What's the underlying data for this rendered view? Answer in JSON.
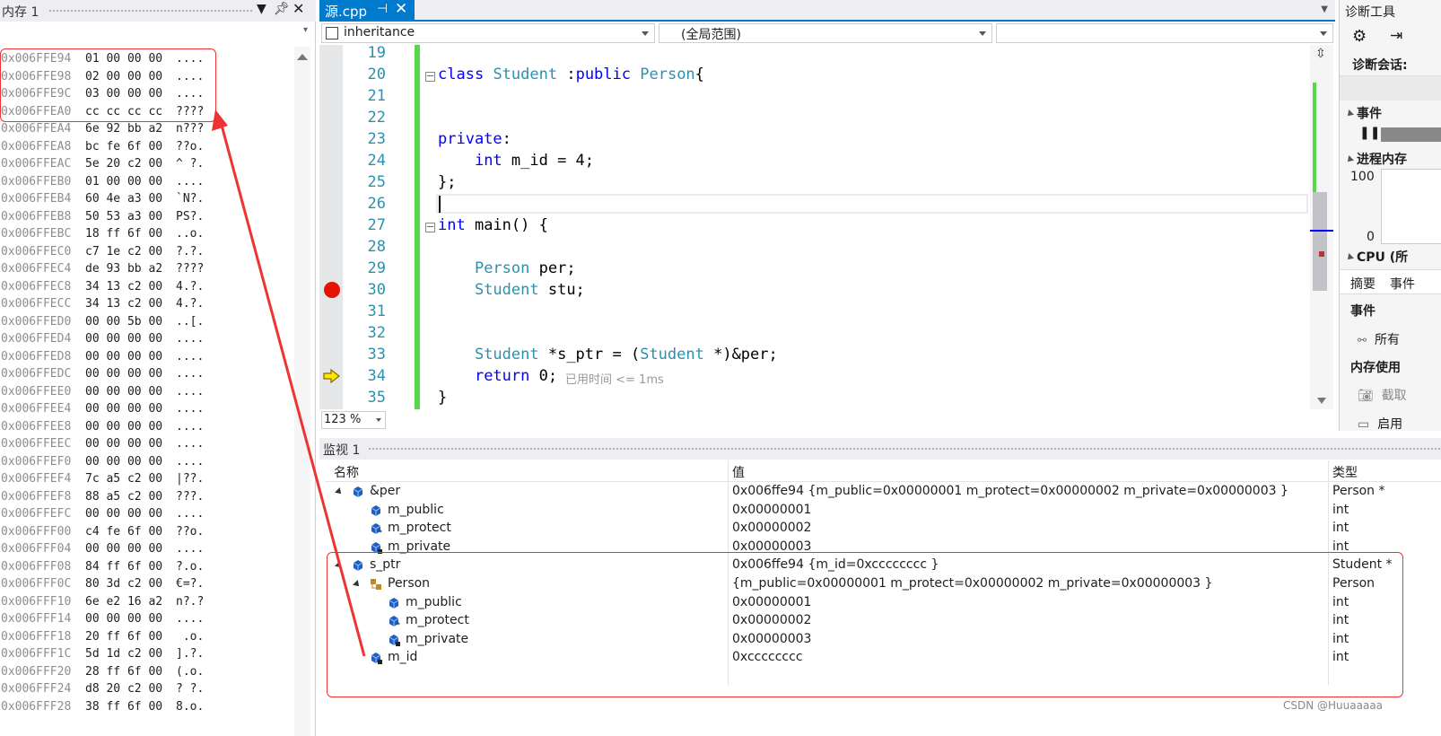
{
  "memory": {
    "title": "内存 1",
    "rows": [
      {
        "addr": "0x006FFE94",
        "hex": "01 00 00 00",
        "ascii": "...."
      },
      {
        "addr": "0x006FFE98",
        "hex": "02 00 00 00",
        "ascii": "...."
      },
      {
        "addr": "0x006FFE9C",
        "hex": "03 00 00 00",
        "ascii": "...."
      },
      {
        "addr": "0x006FFEA0",
        "hex": "cc cc cc cc",
        "ascii": "????"
      },
      {
        "addr": "0x006FFEA4",
        "hex": "6e 92 bb a2",
        "ascii": "n???"
      },
      {
        "addr": "0x006FFEA8",
        "hex": "bc fe 6f 00",
        "ascii": "??o."
      },
      {
        "addr": "0x006FFEAC",
        "hex": "5e 20 c2 00",
        "ascii": "^ ?."
      },
      {
        "addr": "0x006FFEB0",
        "hex": "01 00 00 00",
        "ascii": "...."
      },
      {
        "addr": "0x006FFEB4",
        "hex": "60 4e a3 00",
        "ascii": "`N?."
      },
      {
        "addr": "0x006FFEB8",
        "hex": "50 53 a3 00",
        "ascii": "PS?."
      },
      {
        "addr": "0x006FFEBC",
        "hex": "18 ff 6f 00",
        "ascii": "..o."
      },
      {
        "addr": "0x006FFEC0",
        "hex": "c7 1e c2 00",
        "ascii": "?.?."
      },
      {
        "addr": "0x006FFEC4",
        "hex": "de 93 bb a2",
        "ascii": "????"
      },
      {
        "addr": "0x006FFEC8",
        "hex": "34 13 c2 00",
        "ascii": "4.?."
      },
      {
        "addr": "0x006FFECC",
        "hex": "34 13 c2 00",
        "ascii": "4.?."
      },
      {
        "addr": "0x006FFED0",
        "hex": "00 00 5b 00",
        "ascii": "..[."
      },
      {
        "addr": "0x006FFED4",
        "hex": "00 00 00 00",
        "ascii": "...."
      },
      {
        "addr": "0x006FFED8",
        "hex": "00 00 00 00",
        "ascii": "...."
      },
      {
        "addr": "0x006FFEDC",
        "hex": "00 00 00 00",
        "ascii": "...."
      },
      {
        "addr": "0x006FFEE0",
        "hex": "00 00 00 00",
        "ascii": "...."
      },
      {
        "addr": "0x006FFEE4",
        "hex": "00 00 00 00",
        "ascii": "...."
      },
      {
        "addr": "0x006FFEE8",
        "hex": "00 00 00 00",
        "ascii": "...."
      },
      {
        "addr": "0x006FFEEC",
        "hex": "00 00 00 00",
        "ascii": "...."
      },
      {
        "addr": "0x006FFEF0",
        "hex": "00 00 00 00",
        "ascii": "...."
      },
      {
        "addr": "0x006FFEF4",
        "hex": "7c a5 c2 00",
        "ascii": "|??."
      },
      {
        "addr": "0x006FFEF8",
        "hex": "88 a5 c2 00",
        "ascii": "???."
      },
      {
        "addr": "0x006FFEFC",
        "hex": "00 00 00 00",
        "ascii": "...."
      },
      {
        "addr": "0x006FFF00",
        "hex": "c4 fe 6f 00",
        "ascii": "??o."
      },
      {
        "addr": "0x006FFF04",
        "hex": "00 00 00 00",
        "ascii": "...."
      },
      {
        "addr": "0x006FFF08",
        "hex": "84 ff 6f 00",
        "ascii": "?.o."
      },
      {
        "addr": "0x006FFF0C",
        "hex": "80 3d c2 00",
        "ascii": "€=?."
      },
      {
        "addr": "0x006FFF10",
        "hex": "6e e2 16 a2",
        "ascii": "n?.?"
      },
      {
        "addr": "0x006FFF14",
        "hex": "00 00 00 00",
        "ascii": "...."
      },
      {
        "addr": "0x006FFF18",
        "hex": "20 ff 6f 00",
        "ascii": " .o."
      },
      {
        "addr": "0x006FFF1C",
        "hex": "5d 1d c2 00",
        "ascii": "].?."
      },
      {
        "addr": "0x006FFF20",
        "hex": "28 ff 6f 00",
        "ascii": "(.o."
      },
      {
        "addr": "0x006FFF24",
        "hex": "d8 20 c2 00",
        "ascii": "? ?."
      },
      {
        "addr": "0x006FFF28",
        "hex": "38 ff 6f 00",
        "ascii": "8.o."
      }
    ]
  },
  "editor": {
    "tab": "源.cpp",
    "nav": {
      "project": "inheritance",
      "scope": "(全局范围)",
      "member": ""
    },
    "zoom": "123 %",
    "perf_tip": "已用时间 <= 1ms",
    "lines": [
      {
        "no": "19",
        "tokens": []
      },
      {
        "no": "20",
        "tokens": [
          {
            "t": "class",
            "c": "kw"
          },
          {
            "t": " Student :",
            "c": "ty-mix1"
          },
          {
            "t": "public",
            "c": "kw"
          },
          {
            "t": " Person{",
            "c": "ty-mix2"
          }
        ]
      },
      {
        "no": "21",
        "tokens": []
      },
      {
        "no": "22",
        "tokens": []
      },
      {
        "no": "23",
        "tokens": [
          {
            "t": "private",
            "c": "kw"
          },
          {
            "t": ":",
            "c": ""
          }
        ]
      },
      {
        "no": "24",
        "tokens": [
          {
            "t": "    ",
            "c": ""
          },
          {
            "t": "int",
            "c": "kw"
          },
          {
            "t": " m_id = 4;",
            "c": ""
          }
        ]
      },
      {
        "no": "25",
        "tokens": [
          {
            "t": "};",
            "c": ""
          }
        ]
      },
      {
        "no": "26",
        "tokens": []
      },
      {
        "no": "27",
        "tokens": [
          {
            "t": "int",
            "c": "kw"
          },
          {
            "t": " main() {",
            "c": ""
          }
        ]
      },
      {
        "no": "28",
        "tokens": []
      },
      {
        "no": "29",
        "tokens": [
          {
            "t": "    ",
            "c": ""
          },
          {
            "t": "Person",
            "c": "ty"
          },
          {
            "t": " per;",
            "c": ""
          }
        ]
      },
      {
        "no": "30",
        "tokens": [
          {
            "t": "    ",
            "c": ""
          },
          {
            "t": "Student",
            "c": "ty"
          },
          {
            "t": " stu;",
            "c": ""
          }
        ]
      },
      {
        "no": "31",
        "tokens": []
      },
      {
        "no": "32",
        "tokens": []
      },
      {
        "no": "33",
        "tokens": [
          {
            "t": "    ",
            "c": ""
          },
          {
            "t": "Student",
            "c": "ty"
          },
          {
            "t": " *s_ptr = (",
            "c": ""
          },
          {
            "t": "Student",
            "c": "ty"
          },
          {
            "t": " *)&per;",
            "c": ""
          }
        ]
      },
      {
        "no": "34",
        "tokens": [
          {
            "t": "    ",
            "c": ""
          },
          {
            "t": "return",
            "c": "kw"
          },
          {
            "t": " 0;",
            "c": ""
          }
        ]
      },
      {
        "no": "35",
        "tokens": [
          {
            "t": "}",
            "c": ""
          }
        ]
      }
    ]
  },
  "diagnostics": {
    "title": "诊断工具",
    "session": "诊断会话:",
    "events": "事件",
    "process_memory": "进程内存",
    "mem_max": "100",
    "mem_min": "0",
    "cpu": "CPU (所",
    "tab_summary": "摘要",
    "tab_events": "事件",
    "events_header": "事件",
    "all_events": "所有",
    "mem_usage": "内存使用",
    "snapshot": "截取",
    "enable": "启用"
  },
  "watch": {
    "title": "监视 1",
    "columns": {
      "name": "名称",
      "value": "值",
      "type": "类型"
    },
    "rows": [
      {
        "name": "&per",
        "value": "0x006ffe94 {m_public=0x00000001 m_protect=0x00000002 m_private=0x00000003 }",
        "type": "Person *"
      },
      {
        "name": "m_public",
        "value": "0x00000001",
        "type": "int"
      },
      {
        "name": "m_protect",
        "value": "0x00000002",
        "type": "int"
      },
      {
        "name": "m_private",
        "value": "0x00000003",
        "type": "int"
      },
      {
        "name": "s_ptr",
        "value": "0x006ffe94 {m_id=0xcccccccc }",
        "type": "Student *"
      },
      {
        "name": "Person",
        "value": "{m_public=0x00000001 m_protect=0x00000002 m_private=0x00000003 }",
        "type": "Person"
      },
      {
        "name": "m_public",
        "value": "0x00000001",
        "type": "int"
      },
      {
        "name": "m_protect",
        "value": "0x00000002",
        "type": "int"
      },
      {
        "name": "m_private",
        "value": "0x00000003",
        "type": "int"
      },
      {
        "name": "m_id",
        "value": "0xcccccccc",
        "type": "int"
      }
    ]
  },
  "watermark": "CSDN @Huuaaaaa",
  "colors": {
    "accent": "#007acc",
    "annotation": "#e33333",
    "keyword": "#0000ff",
    "type": "#2b91af",
    "breakpoint": "#e51400"
  }
}
